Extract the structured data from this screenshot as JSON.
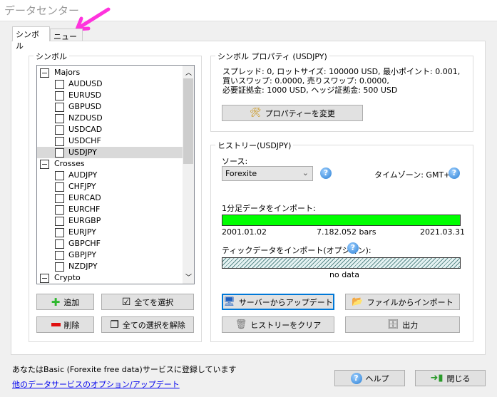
{
  "window": {
    "title": "データセンター"
  },
  "tabs": [
    {
      "label": "シンボル",
      "active": true
    },
    {
      "label": "ニュース",
      "active": false
    }
  ],
  "symbols_group": {
    "label": "シンボル",
    "tree": [
      {
        "label": "Majors",
        "type": "group"
      },
      {
        "label": "AUDUSD"
      },
      {
        "label": "EURUSD"
      },
      {
        "label": "GBPUSD"
      },
      {
        "label": "NZDUSD"
      },
      {
        "label": "USDCAD"
      },
      {
        "label": "USDCHF"
      },
      {
        "label": "USDJPY",
        "selected": true
      },
      {
        "label": "Crosses",
        "type": "group"
      },
      {
        "label": "AUDJPY"
      },
      {
        "label": "CHFJPY"
      },
      {
        "label": "EURCAD"
      },
      {
        "label": "EURCHF"
      },
      {
        "label": "EURGBP"
      },
      {
        "label": "EURJPY"
      },
      {
        "label": "GBPCHF"
      },
      {
        "label": "GBPJPY"
      },
      {
        "label": "NZDJPY"
      },
      {
        "label": "Crypto",
        "type": "group"
      }
    ],
    "buttons": {
      "add": "追加",
      "select_all": "全てを選択",
      "delete": "削除",
      "deselect_all": "全ての選択を解除"
    }
  },
  "properties": {
    "label": "シンボル プロパティ (USDJPY)",
    "line1": "スプレッド: 0, ロットサイズ: 100000 USD, 最小ポイント: 0.001,",
    "line2": "買いスワップ: 0.0000, 売りスワップ: 0.0000,",
    "line3": "必要証拠金: 1000 USD, ヘッジ証拠金: 500 USD",
    "change_button": "プロパティーを変更"
  },
  "history": {
    "label": "ヒストリー(USDJPY)",
    "source_label": "ソース:",
    "source_value": "Forexite",
    "timezone": "タイムゾーン: GMT+0",
    "m1_label": "1分足データをインポート:",
    "m1_progress_percent": 100,
    "m1_start": "2001.01.02",
    "m1_bars": "7.182.052 bars",
    "m1_end": "2021.03.31",
    "tick_label": "ティックデータをインポート(オプション):",
    "tick_status": "no data",
    "buttons": {
      "update": "サーバーからアップデート",
      "import": "ファイルからインポート",
      "clear": "ヒストリーをクリア",
      "export": "出力"
    }
  },
  "footer": {
    "status": "あなたはBasic (Forexite free data)サービスに登録しています",
    "link": "他のデータサービスのオプション/アップデート",
    "help": "ヘルプ",
    "close": "閉じる"
  },
  "colors": {
    "progress": "#00ff00",
    "annotation_arrow": "#ff33dd",
    "focus": "#0078d7"
  }
}
